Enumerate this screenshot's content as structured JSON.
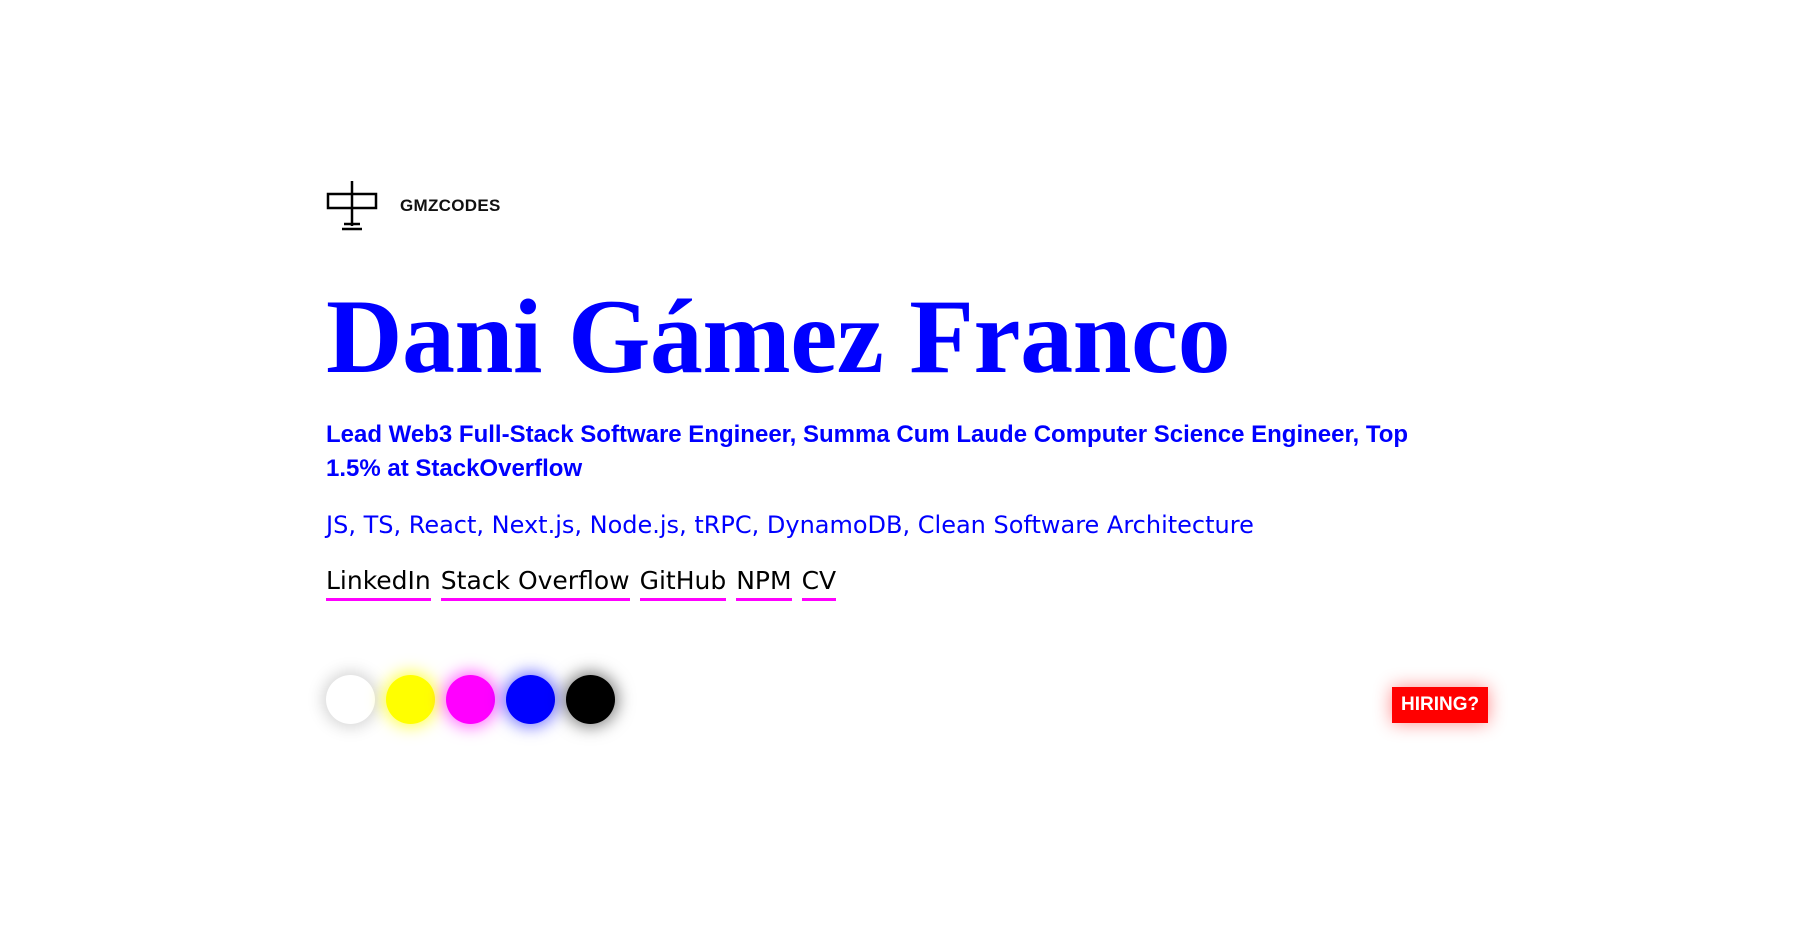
{
  "brand": {
    "name": "GMZCODES",
    "logo_icon": "signpost-cross-icon"
  },
  "hero": {
    "name": "Dani Gámez Franco",
    "tagline": "Lead Web3 Full-Stack Software Engineer, Summa Cum Laude Computer Science Engineer, Top 1.5% at StackOverflow",
    "stack": "JS, TS, React, Next.js, Node.js, tRPC, DynamoDB, Clean Software Architecture"
  },
  "links": [
    {
      "label": "LinkedIn"
    },
    {
      "label": "Stack Overflow"
    },
    {
      "label": "GitHub"
    },
    {
      "label": "NPM"
    },
    {
      "label": "CV"
    }
  ],
  "theme_swatches": [
    {
      "name": "white",
      "color": "#ffffff",
      "glow": "rgba(0,0,0,0.18)"
    },
    {
      "name": "yellow",
      "color": "#ffff00",
      "glow": "rgba(255,255,0,0.7)"
    },
    {
      "name": "magenta",
      "color": "#ff00ff",
      "glow": "rgba(255,0,255,0.6)"
    },
    {
      "name": "blue",
      "color": "#0000ff",
      "glow": "rgba(0,0,255,0.55)"
    },
    {
      "name": "black",
      "color": "#000000",
      "glow": "rgba(0,0,0,0.5)"
    }
  ],
  "hiring_button": {
    "label": "HIRING?",
    "color": "#ff0000"
  },
  "colors": {
    "accent": "#0000ff",
    "underline": "#ff00ff",
    "text": "#000000"
  }
}
